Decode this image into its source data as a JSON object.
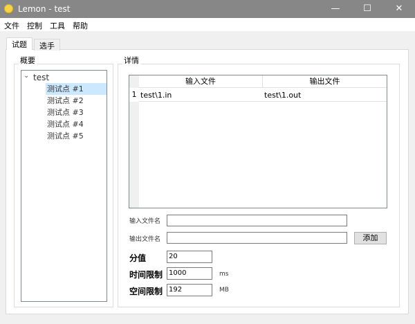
{
  "window": {
    "title": "Lemon - test",
    "minimize": "—",
    "maximize": "☐",
    "close": "✕"
  },
  "menu": [
    "文件",
    "控制",
    "工具",
    "帮助"
  ],
  "tabs": [
    "试题",
    "选手"
  ],
  "overview": {
    "title": "概要",
    "root": "test",
    "items": [
      "测试点 #1",
      "测试点 #2",
      "测试点 #3",
      "测试点 #4",
      "测试点 #5"
    ],
    "selected": 0
  },
  "details": {
    "title": "详情",
    "table": {
      "headers": [
        "输入文件",
        "输出文件"
      ],
      "rows": [
        {
          "num": "1",
          "input": "test\\1.in",
          "output": "test\\1.out"
        }
      ]
    },
    "input_label": "输入文件名",
    "input_value": "",
    "output_label": "输出文件名",
    "output_value": "",
    "add_button": "添加",
    "score_label": "分值",
    "score": "20",
    "time_label": "时间限制",
    "time": "1000",
    "time_unit": "ms",
    "memory_label": "空间限制",
    "memory": "192",
    "memory_unit": "MB"
  }
}
